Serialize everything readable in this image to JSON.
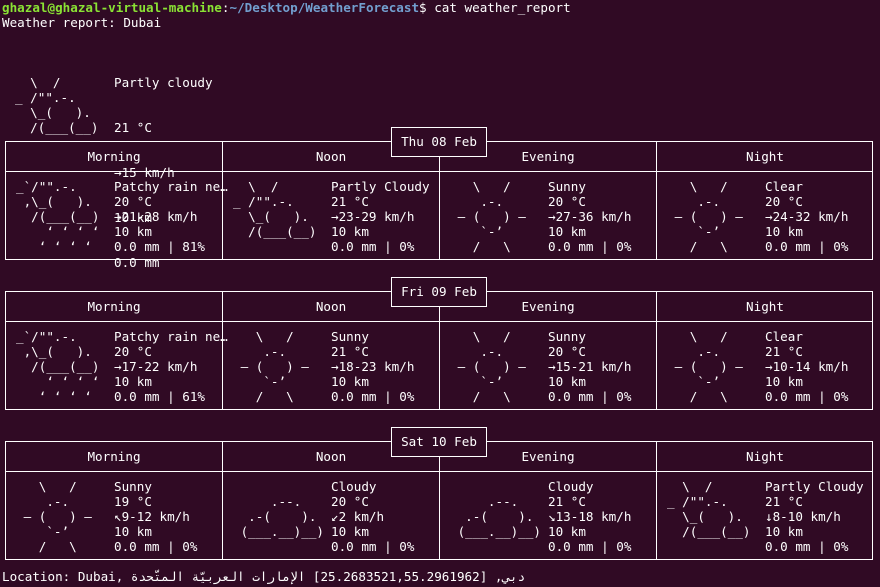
{
  "prompt": {
    "user_host": "ghazal@ghazal-virtual-machine",
    "separator": ":",
    "path": "~/Desktop/WeatherForecast",
    "symbol": "$",
    "command": " cat weather_report"
  },
  "report_title": "Weather report: Dubai",
  "current": {
    "art": [
      "  \\  /",
      "_ /\"\".-.",
      "  \\_(   ).",
      "  /(___(__)"
    ],
    "info": [
      "Partly cloudy",
      "21 °C",
      "→15 km/h",
      "10 km",
      "0.0 mm"
    ]
  },
  "periods": [
    "Morning",
    "Noon",
    "Evening",
    "Night"
  ],
  "days": [
    {
      "label": "Thu 08 Feb",
      "slots": [
        {
          "art": [
            "_`/\"\".-.",
            " ,\\_(   ).",
            "  /(___(__)",
            "    ‘ ‘ ‘ ‘",
            "   ‘ ‘ ‘ ‘"
          ],
          "info": [
            "Patchy rain ne…",
            "20 °C",
            "→21-28 km/h",
            "10 km",
            "0.0 mm | 81%"
          ]
        },
        {
          "art": [
            "  \\  /",
            "_ /\"\".-.",
            "  \\_(   ).",
            "  /(___(__)",
            ""
          ],
          "info": [
            "Partly Cloudy",
            "21 °C",
            "→23-29 km/h",
            "10 km",
            "0.0 mm | 0%"
          ]
        },
        {
          "art": [
            "   \\   /",
            "    .-.",
            " ― (   ) ―",
            "    `-’",
            "   /   \\"
          ],
          "info": [
            "Sunny",
            "20 °C",
            "→27-36 km/h",
            "10 km",
            "0.0 mm | 0%"
          ]
        },
        {
          "art": [
            "   \\   /",
            "    .-.",
            " ― (   ) ―",
            "    `-’",
            "   /   \\"
          ],
          "info": [
            "Clear",
            "20 °C",
            "→24-32 km/h",
            "10 km",
            "0.0 mm | 0%"
          ]
        }
      ]
    },
    {
      "label": "Fri 09 Feb",
      "slots": [
        {
          "art": [
            "_`/\"\".-.",
            " ,\\_(   ).",
            "  /(___(__)",
            "    ‘ ‘ ‘ ‘",
            "   ‘ ‘ ‘ ‘"
          ],
          "info": [
            "Patchy rain ne…",
            "20 °C",
            "→17-22 km/h",
            "10 km",
            "0.0 mm | 61%"
          ]
        },
        {
          "art": [
            "   \\   /",
            "    .-.",
            " ― (   ) ―",
            "    `-’",
            "   /   \\"
          ],
          "info": [
            "Sunny",
            "21 °C",
            "→18-23 km/h",
            "10 km",
            "0.0 mm | 0%"
          ]
        },
        {
          "art": [
            "   \\   /",
            "    .-.",
            " ― (   ) ―",
            "    `-’",
            "   /   \\"
          ],
          "info": [
            "Sunny",
            "20 °C",
            "→15-21 km/h",
            "10 km",
            "0.0 mm | 0%"
          ]
        },
        {
          "art": [
            "   \\   /",
            "    .-.",
            " ― (   ) ―",
            "    `-’",
            "   /   \\"
          ],
          "info": [
            "Clear",
            "21 °C",
            "→10-14 km/h",
            "10 km",
            "0.0 mm | 0%"
          ]
        }
      ]
    },
    {
      "label": "Sat 10 Feb",
      "slots": [
        {
          "art": [
            "   \\   /",
            "    .-.",
            " ― (   ) ―",
            "    `-’",
            "   /   \\"
          ],
          "info": [
            "Sunny",
            "19 °C",
            "↖9-12 km/h",
            "10 km",
            "0.0 mm | 0%"
          ]
        },
        {
          "art": [
            "",
            "     .--.",
            "  .-(    ).",
            " (___.__)__)",
            ""
          ],
          "info": [
            "Cloudy",
            "20 °C",
            "↙2 km/h",
            "10 km",
            "0.0 mm | 0%"
          ]
        },
        {
          "art": [
            "",
            "     .--.",
            "  .-(    ).",
            " (___.__)__)",
            ""
          ],
          "info": [
            "Cloudy",
            "21 °C",
            "↘13-18 km/h",
            "10 km",
            "0.0 mm | 0%"
          ]
        },
        {
          "art": [
            "  \\  /",
            "_ /\"\".-.",
            "  \\_(   ).",
            "  /(___(__)",
            ""
          ],
          "info": [
            "Partly Cloudy",
            "21 °C",
            "↓8-10 km/h",
            "10 km",
            "0.0 mm | 0%"
          ]
        }
      ]
    }
  ],
  "location": "Location: Dubai, دبي, [25.2683521,55.2961962] الإمارات العربيّة المتّحدة"
}
